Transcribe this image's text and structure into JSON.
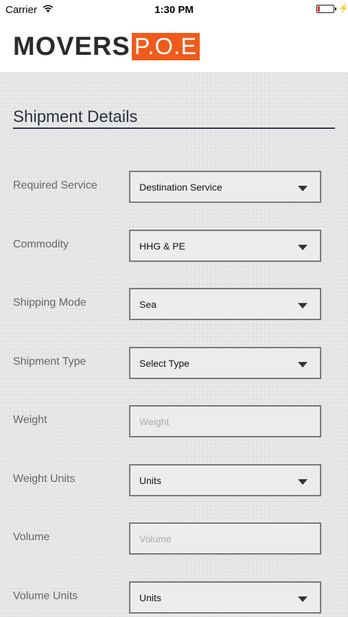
{
  "status_bar": {
    "carrier": "Carrier",
    "time": "1:30 PM",
    "wifi_icon": "wifi-icon",
    "battery_icon": "battery-icon",
    "charging_icon": "bolt-icon"
  },
  "header": {
    "logo_text": "MOVERS",
    "logo_badge": "P.O.E",
    "brand_color": "#f05a1a"
  },
  "section": {
    "title": "Shipment Details"
  },
  "fields": [
    {
      "label": "Required Service",
      "type": "select",
      "value": "Destination Service"
    },
    {
      "label": "Commodity",
      "type": "select",
      "value": "HHG & PE"
    },
    {
      "label": "Shipping Mode",
      "type": "select",
      "value": "Sea"
    },
    {
      "label": "Shipment Type",
      "type": "select",
      "value": "Select Type"
    },
    {
      "label": "Weight",
      "type": "input",
      "value": "",
      "placeholder": "Weight"
    },
    {
      "label": "Weight Units",
      "type": "select",
      "value": "Units"
    },
    {
      "label": "Volume",
      "type": "input",
      "value": "",
      "placeholder": "Volume"
    },
    {
      "label": "Volume Units",
      "type": "select",
      "value": "Units"
    }
  ]
}
